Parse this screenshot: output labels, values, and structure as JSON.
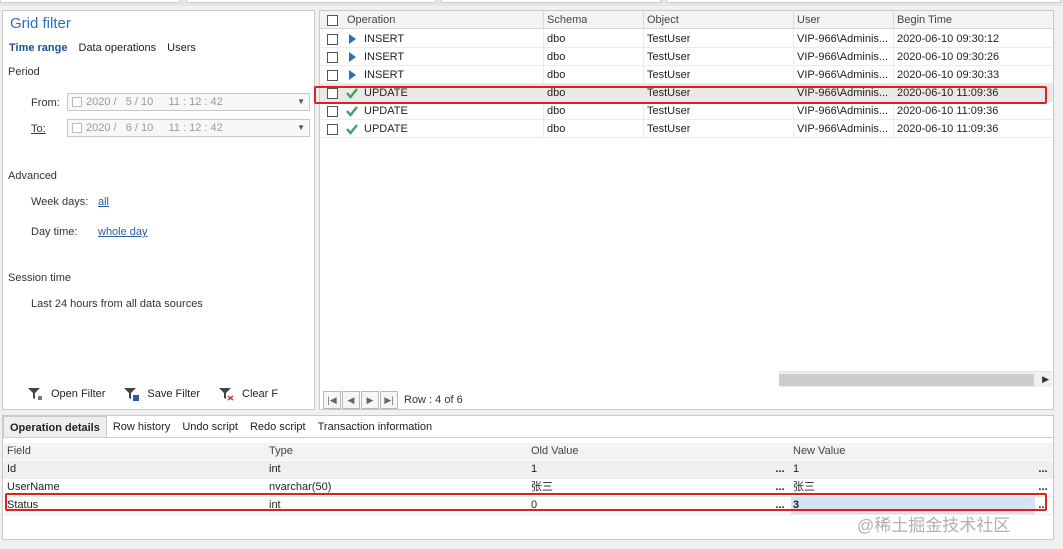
{
  "filter_panel": {
    "title": "Grid filter",
    "tabs": [
      "Time range",
      "Data operations",
      "Users"
    ],
    "period_label": "Period",
    "from_label": "From:",
    "from_value": "2020 /   5 / 10     11 : 12 : 42",
    "to_label": "To:",
    "to_value": "2020 /   6 / 10     11 : 12 : 42",
    "advanced_label": "Advanced",
    "week_days_label": "Week days:",
    "week_days_value": "all",
    "day_time_label": "Day time:",
    "day_time_value": "whole day",
    "session_time_label": "Session time",
    "session_time_value": "Last 24 hours from all data sources",
    "open_filter_label": "Open Filter",
    "save_filter_label": "Save Filter",
    "clear_filter_label": "Clear F"
  },
  "grid": {
    "columns": [
      "Operation",
      "Schema",
      "Object",
      "User",
      "Begin Time"
    ],
    "rows": [
      {
        "operation": "INSERT",
        "schema": "dbo",
        "object": "TestUser",
        "user": "VIP-966\\Adminis...",
        "begin_time": "2020-06-10 09:30:12",
        "icon": "play-icon"
      },
      {
        "operation": "INSERT",
        "schema": "dbo",
        "object": "TestUser",
        "user": "VIP-966\\Adminis...",
        "begin_time": "2020-06-10 09:30:26",
        "icon": "play-icon"
      },
      {
        "operation": "INSERT",
        "schema": "dbo",
        "object": "TestUser",
        "user": "VIP-966\\Adminis...",
        "begin_time": "2020-06-10 09:30:33",
        "icon": "play-icon"
      },
      {
        "operation": "UPDATE",
        "schema": "dbo",
        "object": "TestUser",
        "user": "VIP-966\\Adminis...",
        "begin_time": "2020-06-10 11:09:36",
        "icon": "checkmark-icon"
      },
      {
        "operation": "UPDATE",
        "schema": "dbo",
        "object": "TestUser",
        "user": "VIP-966\\Adminis...",
        "begin_time": "2020-06-10 11:09:36",
        "icon": "checkmark-icon"
      },
      {
        "operation": "UPDATE",
        "schema": "dbo",
        "object": "TestUser",
        "user": "VIP-966\\Adminis...",
        "begin_time": "2020-06-10 11:09:36",
        "icon": "checkmark-icon"
      }
    ],
    "row_status": "Row : 4 of 6"
  },
  "details": {
    "tabs": [
      "Operation details",
      "Row history",
      "Undo script",
      "Redo script",
      "Transaction information"
    ],
    "columns": [
      "Field",
      "Type",
      "Old Value",
      "New Value"
    ],
    "rows": [
      {
        "field": "Id",
        "type": "int",
        "old": "1",
        "new": "1"
      },
      {
        "field": "UserName",
        "type": "nvarchar(50)",
        "old": "张三",
        "new": "张三"
      },
      {
        "field": "Status",
        "type": "int",
        "old": "0",
        "new": "3"
      }
    ],
    "ellipsis": "..."
  },
  "watermark": "@稀土掘金技术社区",
  "colors": {
    "accent": "#2d6ebf",
    "highlight_red": "#e02020",
    "update_green": "#3aa55a",
    "insert_blue": "#2f6fb8"
  }
}
